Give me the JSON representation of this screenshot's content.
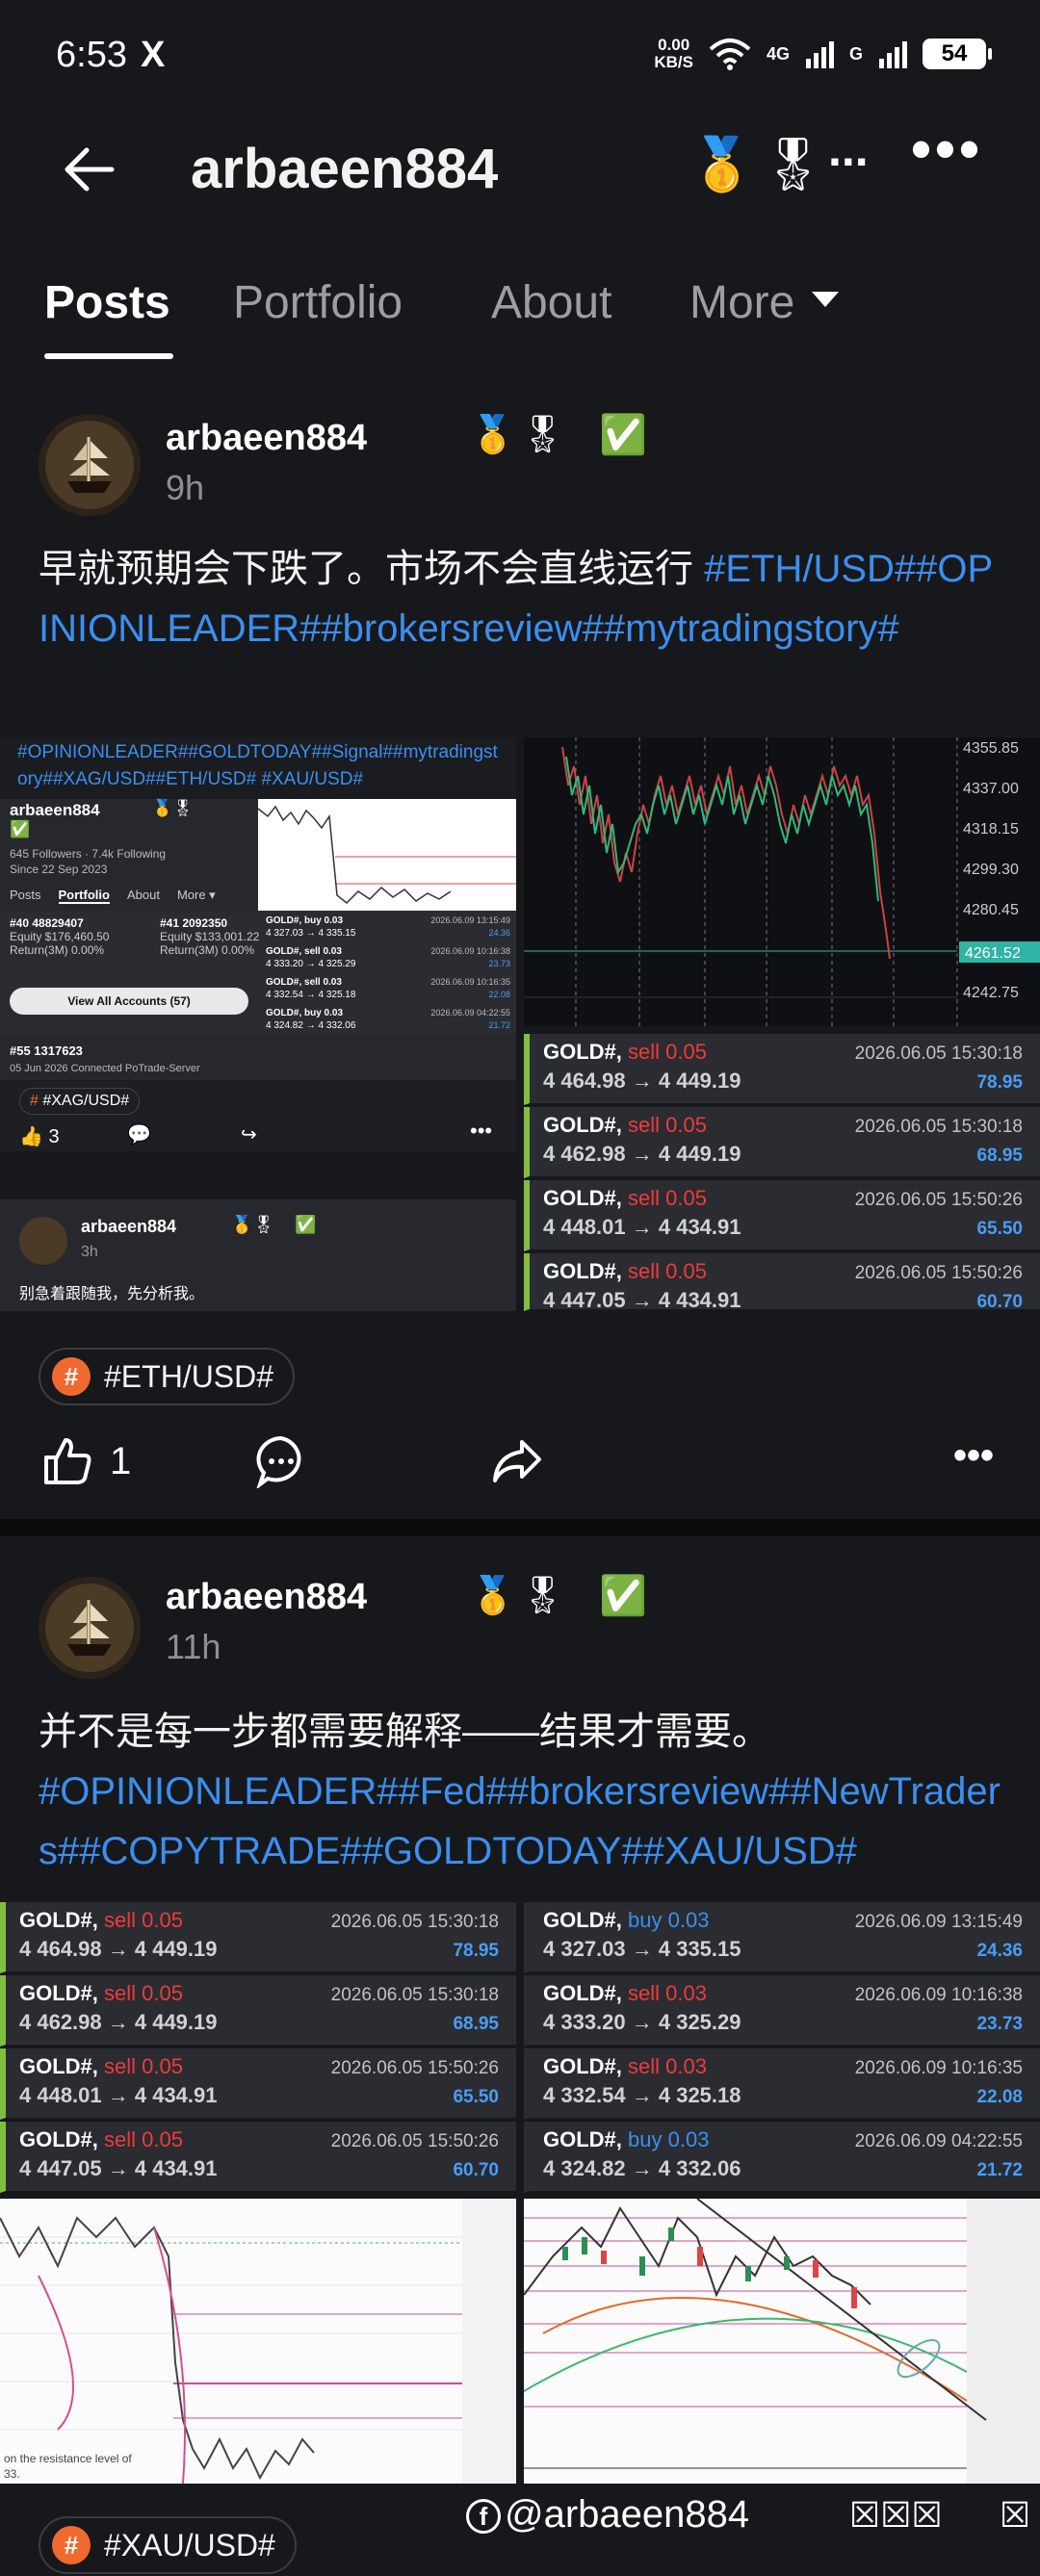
{
  "status": {
    "time": "6:53",
    "x_icon": "X",
    "net_speed": "0.00",
    "net_unit": "KB/S",
    "sig1": "4G",
    "sig2": "G",
    "battery": "54"
  },
  "header": {
    "title": "arbaeen884",
    "medals": "🥇🎖",
    "overflow": "..."
  },
  "tabs": [
    {
      "label": "Posts"
    },
    {
      "label": "Portfolio"
    },
    {
      "label": "About"
    },
    {
      "label": "More"
    }
  ],
  "post1": {
    "author": "arbaeen884",
    "medals": "🥇🎖",
    "verified": "✅",
    "time": "9h",
    "text": "早就预期会下跌了。市场不会直线运行 ",
    "tags": "#ETH/USD##OPINIONLEADER##brokersreview##mytradingstory#",
    "chip": "#ETH/USD#",
    "likes": "1",
    "embed": {
      "tagline": "#OPINIONLEADER##GOLDTODAY##Signal##mytradingstory##XAG/USD##ETH/USD# #XAU/USD#",
      "profile_name": "arbaeen884",
      "followers": "645 Followers · 7.4k Following",
      "since": "Since 22 Sep 2023",
      "tabs": [
        "Posts",
        "Portfolio",
        "About",
        "More ▾"
      ],
      "acc1": {
        "id": "#40 48829407",
        "equity": "Equity $176,460.50",
        "ret": "Return(3M) 0.00%"
      },
      "acc2": {
        "id": "#41 2092350",
        "equity": "Equity $133,001.22",
        "ret": "Return(3M) 0.00%"
      },
      "view_all": "View All Accounts (57)",
      "acc3": {
        "id": "#55 1317623",
        "sub": "05 Jun 2026 Connected  PoTrade-Server"
      },
      "mini_trades": [
        {
          "a": "GOLD#, buy 0.03",
          "b": "4 327.03 → 4 335.15",
          "d": "2026.06.09 13:15:49",
          "p": "24.36"
        },
        {
          "a": "GOLD#, sell 0.03",
          "b": "4 333.20 → 4 325.29",
          "d": "2026.06.09 10:16:38",
          "p": "23.73"
        },
        {
          "a": "GOLD#, sell 0.03",
          "b": "4 332.54 → 4 325.18",
          "d": "2026.06.09 10:16:35",
          "p": "22.08"
        },
        {
          "a": "GOLD#, buy 0.03",
          "b": "4 324.82 → 4 332.06",
          "d": "2026.06.09 04:22:55",
          "p": "21.72"
        }
      ],
      "chip": "#XAG/USD#",
      "likes": "3",
      "comment_author": "arbaeen884",
      "comment_time": "3h",
      "comment_text": "别急着跟随我，先分析我。"
    },
    "chart_axis": [
      "4355.85",
      "4337.00",
      "4318.15",
      "4299.30",
      "4280.45",
      "4261.52",
      "4242.75"
    ],
    "trades": [
      {
        "sym": "GOLD#,",
        "side": "sell 0.05",
        "range": "4 464.98 → 4 449.19",
        "date": "2026.06.05 15:30:18",
        "profit": "78.95"
      },
      {
        "sym": "GOLD#,",
        "side": "sell 0.05",
        "range": "4 462.98 → 4 449.19",
        "date": "2026.06.05 15:30:18",
        "profit": "68.95"
      },
      {
        "sym": "GOLD#,",
        "side": "sell 0.05",
        "range": "4 448.01 → 4 434.91",
        "date": "2026.06.05 15:50:26",
        "profit": "65.50"
      },
      {
        "sym": "GOLD#,",
        "side": "sell 0.05",
        "range": "4 447.05 → 4 434.91",
        "date": "2026.06.05 15:50:26",
        "profit": "60.70"
      }
    ]
  },
  "post2": {
    "author": "arbaeen884",
    "medals": "🥇🎖",
    "verified": "✅",
    "time": "11h",
    "text": "并不是每一步都需要解释——结果才需要。",
    "tags": "#OPINIONLEADER##Fed##brokersreview##NewTraders##COPYTRADE##GOLDTODAY##XAU/USD#",
    "chip": "#XAU/USD#",
    "trades_left": [
      {
        "sym": "GOLD#,",
        "side": "sell 0.05",
        "range": "4 464.98 → 4 449.19",
        "date": "2026.06.05 15:30:18",
        "profit": "78.95"
      },
      {
        "sym": "GOLD#,",
        "side": "sell 0.05",
        "range": "4 462.98 → 4 449.19",
        "date": "2026.06.05 15:30:18",
        "profit": "68.95"
      },
      {
        "sym": "GOLD#,",
        "side": "sell 0.05",
        "range": "4 448.01 → 4 434.91",
        "date": "2026.06.05 15:50:26",
        "profit": "65.50"
      },
      {
        "sym": "GOLD#,",
        "side": "sell 0.05",
        "range": "4 447.05 → 4 434.91",
        "date": "2026.06.05 15:50:26",
        "profit": "60.70"
      }
    ],
    "trades_right": [
      {
        "sym": "GOLD#,",
        "side": "buy 0.03",
        "range": "4 327.03 → 4 335.15",
        "date": "2026.06.09 13:15:49",
        "profit": "24.36"
      },
      {
        "sym": "GOLD#,",
        "side": "sell 0.03",
        "range": "4 333.20 → 4 325.29",
        "date": "2026.06.09 10:16:38",
        "profit": "23.73"
      },
      {
        "sym": "GOLD#,",
        "side": "sell 0.03",
        "range": "4 332.54 → 4 325.18",
        "date": "2026.06.09 10:16:35",
        "profit": "22.08"
      },
      {
        "sym": "GOLD#,",
        "side": "buy 0.03",
        "range": "4 324.82 → 4 332.06",
        "date": "2026.06.09 04:22:55",
        "profit": "21.72"
      }
    ],
    "chart_note": "on the resistance level of",
    "chart_note2": "33."
  },
  "watermark": {
    "handle": "@arbaeen884",
    "icon": "f",
    "tail1": "☒☒☒",
    "tail2": "☒"
  }
}
